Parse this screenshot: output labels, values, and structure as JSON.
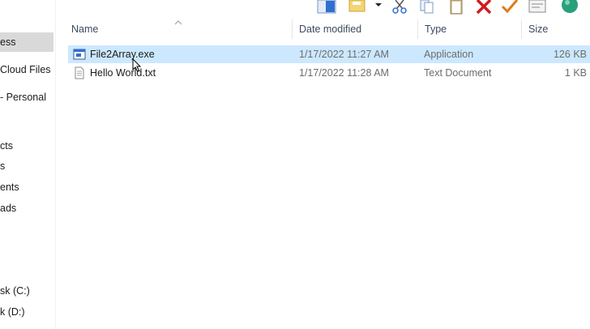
{
  "nav": {
    "items": [
      {
        "label": "ess",
        "selected": true
      },
      {
        "label": "Cloud Files"
      },
      {
        "label": "- Personal"
      },
      {
        "label": "cts"
      },
      {
        "label": "s"
      },
      {
        "label": "ents"
      },
      {
        "label": "ads"
      },
      {
        "label": "sk (C:)"
      },
      {
        "label": "k (D:)"
      }
    ]
  },
  "toolbar": {
    "icons": [
      "details-pane-icon",
      "new-folder-icon",
      "dropdown-arrow-icon",
      "cut-icon",
      "copy-icon",
      "paste-icon",
      "delete-icon",
      "checkmark-icon",
      "properties-icon",
      "globe-icon"
    ]
  },
  "columns": {
    "name": "Name",
    "date": "Date modified",
    "type": "Type",
    "size": "Size"
  },
  "files": [
    {
      "name": "File2Array.exe",
      "date": "1/17/2022 11:27 AM",
      "type": "Application",
      "size": "126 KB",
      "icon": "application-icon",
      "selected": true
    },
    {
      "name": "Hello World.txt",
      "date": "1/17/2022 11:28 AM",
      "type": "Text Document",
      "size": "1 KB",
      "icon": "text-document-icon",
      "selected": false
    }
  ],
  "colors": {
    "selection": "#cce8ff",
    "nav_selected": "#d9d9d9",
    "header_text": "#3b4a5e",
    "secondary_text": "#6d6d6d"
  }
}
